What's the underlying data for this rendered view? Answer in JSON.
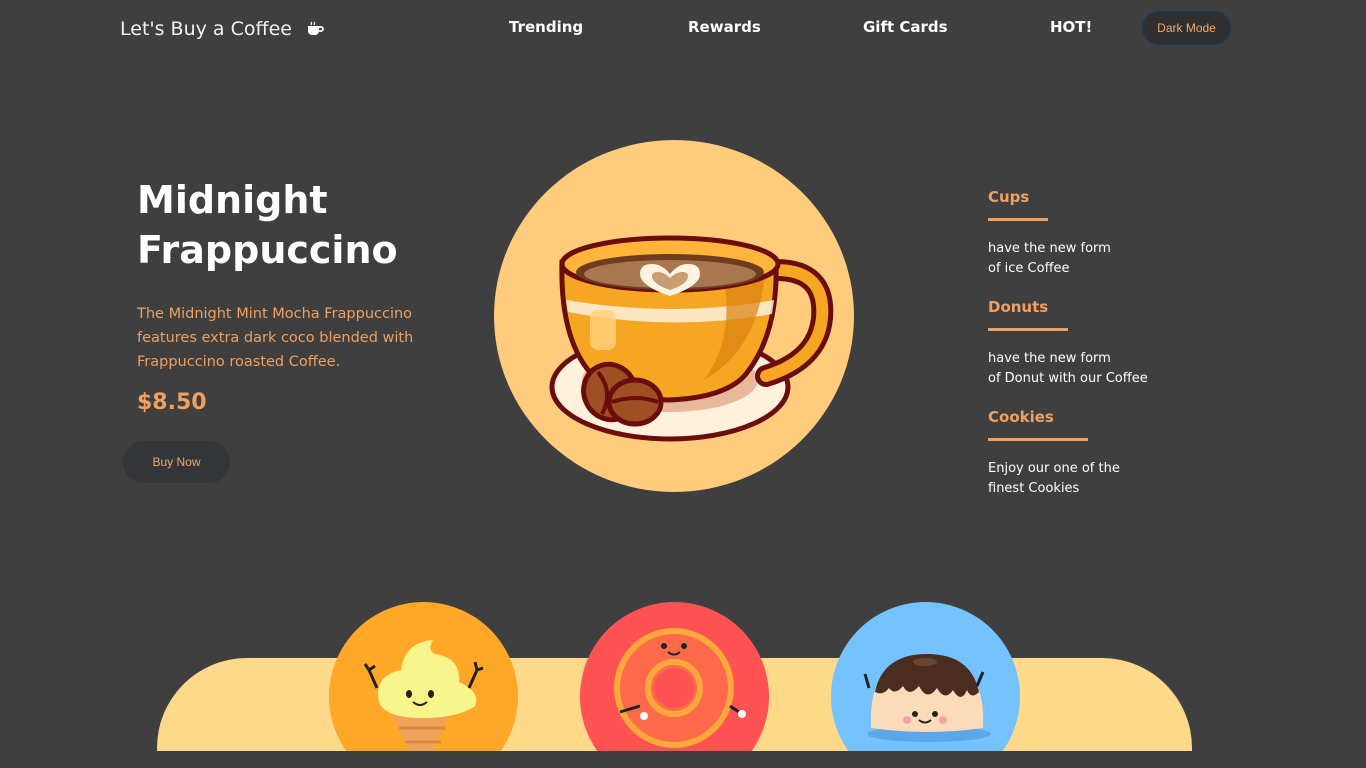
{
  "nav": {
    "brand": "Let's Buy a Coffee",
    "brand_icon": "coffee-cup-icon",
    "links": [
      "Trending",
      "Rewards",
      "Gift Cards",
      "HOT!"
    ],
    "dark_mode_label": "Dark Mode"
  },
  "hero": {
    "title_line1": "Midnight",
    "title_line2": "Frappuccino",
    "description": "The Midnight Mint Mocha Frappuccino features extra dark coco blended with Frappuccino roasted Coffee.",
    "price": "$8.50",
    "buy_label": "Buy Now",
    "image_icon": "coffee-cup-illustration"
  },
  "features": [
    {
      "title": "Cups",
      "line1": "have the new form",
      "line2": "of ice Coffee"
    },
    {
      "title": "Donuts",
      "line1": "have the new form",
      "line2": "of Donut with our Coffee"
    },
    {
      "title": "Cookies",
      "line1": "Enjoy our one of the",
      "line2": "finest Cookies"
    }
  ],
  "treats": [
    {
      "name": "ice-cream-illustration",
      "color": "#ffa726"
    },
    {
      "name": "donut-illustration",
      "color": "#ff5252"
    },
    {
      "name": "pudding-illustration",
      "color": "#74c2ff"
    }
  ],
  "colors": {
    "background": "#3f3f3f",
    "accent": "#f0a060",
    "hero_circle": "#ffcb7d",
    "bottom_band": "#ffd98a"
  }
}
